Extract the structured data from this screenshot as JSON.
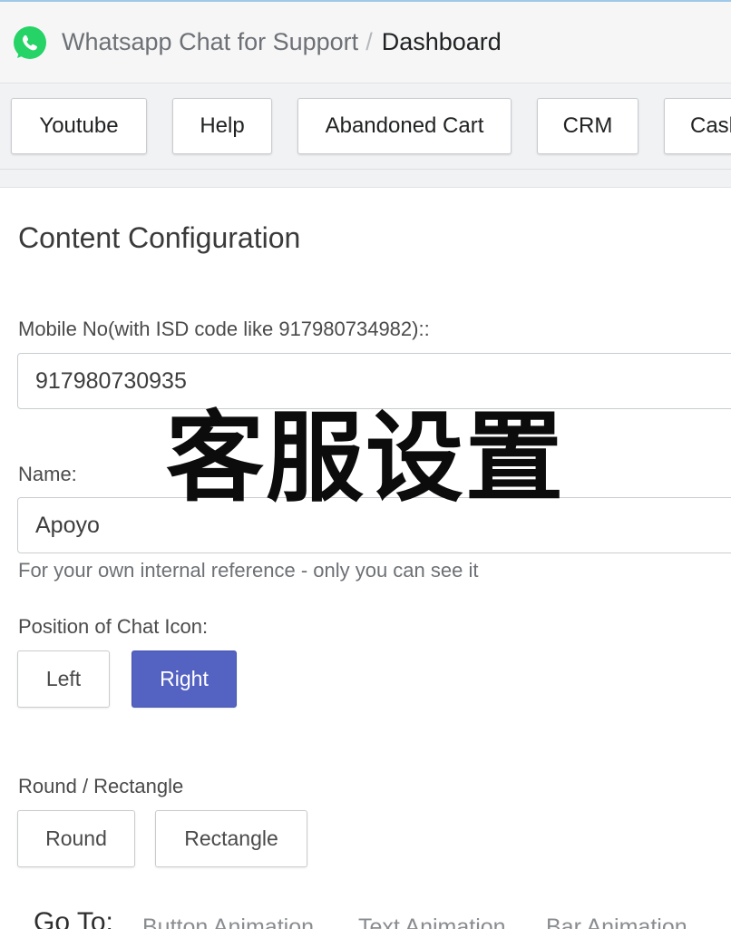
{
  "header": {
    "app_name": "Whatsapp Chat for Support",
    "separator": "/",
    "current_page": "Dashboard",
    "brand_color": "#25D366"
  },
  "nav": {
    "buttons": [
      "Youtube",
      "Help",
      "Abandoned Cart",
      "CRM",
      "Cash"
    ]
  },
  "content": {
    "section_title": "Content Configuration",
    "mobile": {
      "label": "Mobile No(with ISD code like 917980734982)::",
      "value": "917980730935"
    },
    "name": {
      "label": "Name:",
      "value": "Apoyo",
      "help": "For your own internal reference - only you can see it"
    },
    "position": {
      "label": "Position of Chat Icon:",
      "options": [
        "Left",
        "Right"
      ],
      "selected": "Right",
      "accent_color": "#5462C2"
    },
    "shape": {
      "label": "Round / Rectangle",
      "options": [
        "Round",
        "Rectangle"
      ]
    }
  },
  "goto": {
    "label": "Go To:",
    "links": [
      "Button Animation",
      "Text Animation",
      "Bar Animation"
    ]
  },
  "overlay": {
    "caption": "客服设置"
  }
}
